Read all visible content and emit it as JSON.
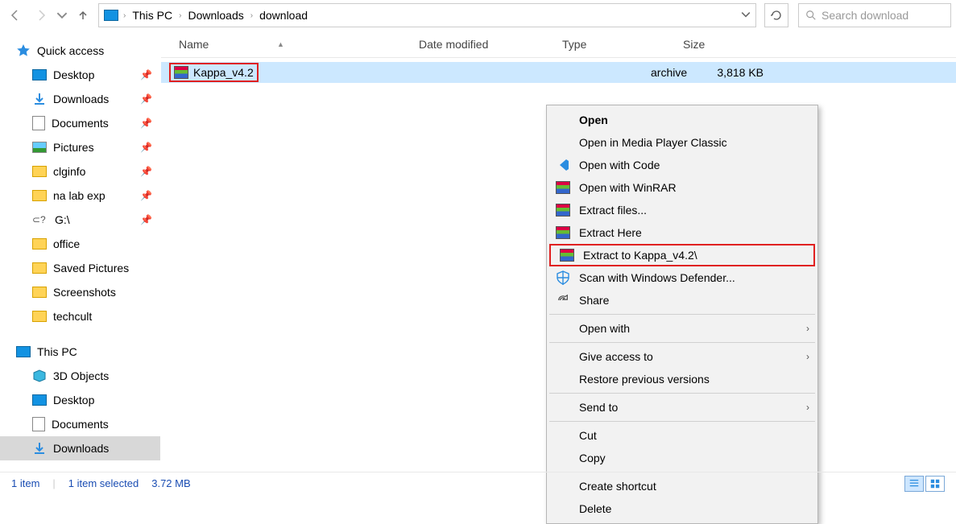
{
  "nav": {
    "breadcrumb": {
      "root_icon": "monitor",
      "seg1": "This PC",
      "seg2": "Downloads",
      "seg3": "download"
    },
    "search_placeholder": "Search download"
  },
  "sidebar": {
    "quick_access": "Quick access",
    "items": [
      {
        "label": "Desktop"
      },
      {
        "label": "Downloads"
      },
      {
        "label": "Documents"
      },
      {
        "label": "Pictures"
      },
      {
        "label": "clginfo"
      },
      {
        "label": "na lab exp"
      },
      {
        "label": "G:\\"
      },
      {
        "label": "office"
      },
      {
        "label": "Saved Pictures"
      },
      {
        "label": "Screenshots"
      },
      {
        "label": "techcult"
      }
    ],
    "this_pc": "This PC",
    "pc_items": [
      {
        "label": "3D Objects"
      },
      {
        "label": "Desktop"
      },
      {
        "label": "Documents"
      },
      {
        "label": "Downloads"
      }
    ]
  },
  "columns": {
    "name": "Name",
    "date": "Date modified",
    "type": "Type",
    "size": "Size"
  },
  "file": {
    "name": "Kappa_v4.2",
    "type_visible": "archive",
    "size": "3,818 KB"
  },
  "context_menu": {
    "open": "Open",
    "open_mpc": "Open in Media Player Classic",
    "open_code": "Open with Code",
    "open_winrar": "Open with WinRAR",
    "extract_files": "Extract files...",
    "extract_here": "Extract Here",
    "extract_to": "Extract to Kappa_v4.2\\",
    "scan_defender": "Scan with Windows Defender...",
    "share": "Share",
    "open_with": "Open with",
    "give_access": "Give access to",
    "restore": "Restore previous versions",
    "send_to": "Send to",
    "cut": "Cut",
    "copy": "Copy",
    "create_shortcut": "Create shortcut",
    "delete": "Delete"
  },
  "status": {
    "count": "1 item",
    "selected": "1 item selected",
    "size": "3.72 MB"
  }
}
